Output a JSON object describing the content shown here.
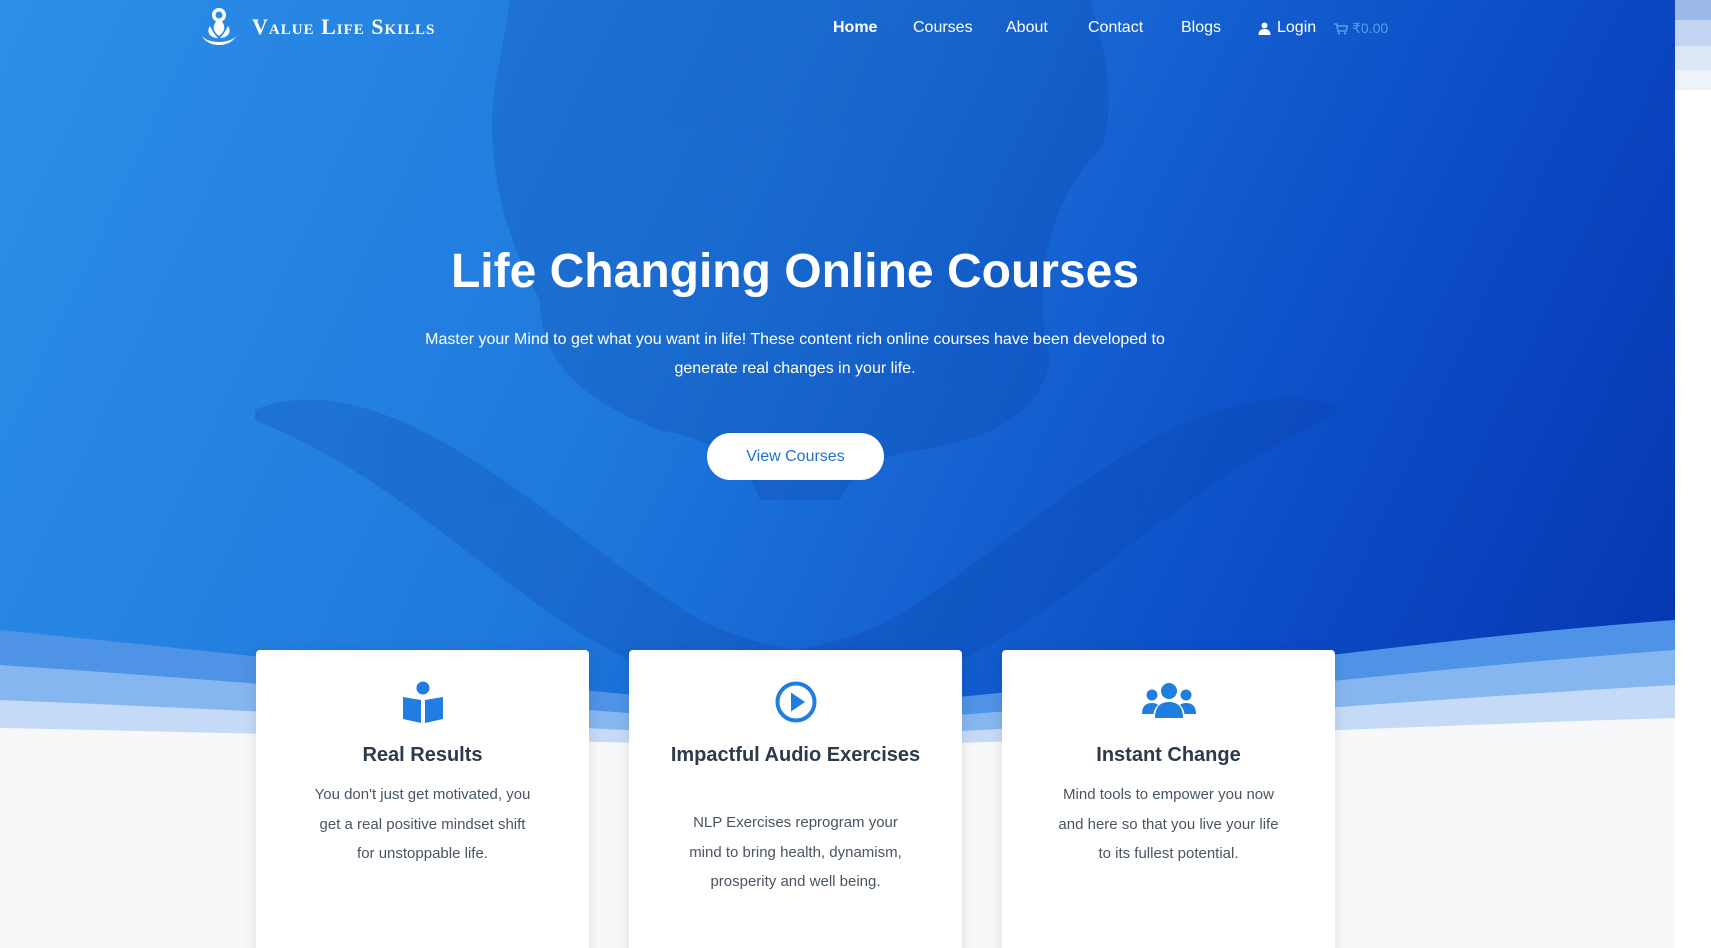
{
  "brand": {
    "name": "Value Life Skills"
  },
  "nav": {
    "home": "Home",
    "courses": "Courses",
    "about": "About",
    "contact": "Contact",
    "blogs": "Blogs",
    "login": "Login",
    "cart_total": "₹0.00"
  },
  "hero": {
    "title": "Life Changing Online Courses",
    "subtitle": "Master your Mind to get what you want in life! These content rich online courses have been developed to generate real changes in your life.",
    "button": "View Courses"
  },
  "features": [
    {
      "icon": "book-icon",
      "title": "Real Results",
      "body": "You don't just get motivated, you get a real positive mindset shift for unstoppable life."
    },
    {
      "icon": "play-circle-icon",
      "title": "Impactful Audio Exercises",
      "body": "NLP Exercises reprogram your mind to bring health, dynamism, prosperity and well being."
    },
    {
      "icon": "users-icon",
      "title": "Instant Change",
      "body": "Mind tools to empower you now and here so that you live your life to its fullest potential."
    }
  ],
  "colors": {
    "accent": "#1f7ee0",
    "hero_start": "#2c8fe6",
    "hero_end": "#0535b0",
    "cart": "#5d9bf2"
  }
}
